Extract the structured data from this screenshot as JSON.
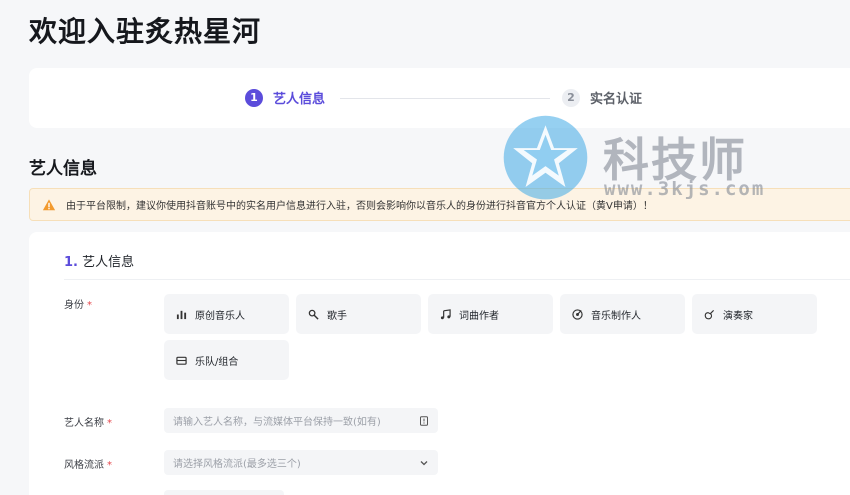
{
  "page": {
    "title": "欢迎入驻炙热星河"
  },
  "steps": [
    {
      "num": "1",
      "label": "艺人信息"
    },
    {
      "num": "2",
      "label": "实名认证"
    }
  ],
  "section": {
    "title": "艺人信息"
  },
  "notice": {
    "text": "由于平台限制，建议你使用抖音账号中的实名用户信息进行入驻，否则会影响你以音乐人的身份进行抖音官方个人认证（黄V申请）！"
  },
  "form": {
    "subtitle_index": "1.",
    "subtitle": "艺人信息",
    "identity_label": "身份",
    "required_mark": "*",
    "identity_options": [
      {
        "label": "原创音乐人",
        "icon": "bar-chart-icon"
      },
      {
        "label": "歌手",
        "icon": "microphone-icon"
      },
      {
        "label": "词曲作者",
        "icon": "music-note-icon"
      },
      {
        "label": "音乐制作人",
        "icon": "vinyl-icon"
      },
      {
        "label": "演奏家",
        "icon": "guitar-icon"
      },
      {
        "label": "乐队/组合",
        "icon": "band-icon"
      }
    ],
    "artist_name_label": "艺人名称",
    "artist_name_placeholder": "请输入艺人名称，与流媒体平台保持一致(如有)",
    "genre_label": "风格流派",
    "genre_placeholder": "请选择风格流派(最多选三个)"
  },
  "watermark": {
    "title": "科技师",
    "url": "www.3kjs.com"
  },
  "colors": {
    "accent": "#5b4cdb",
    "required": "#e5484d",
    "notice_bg": "#fdf3e4",
    "warning": "#f29a2e"
  }
}
